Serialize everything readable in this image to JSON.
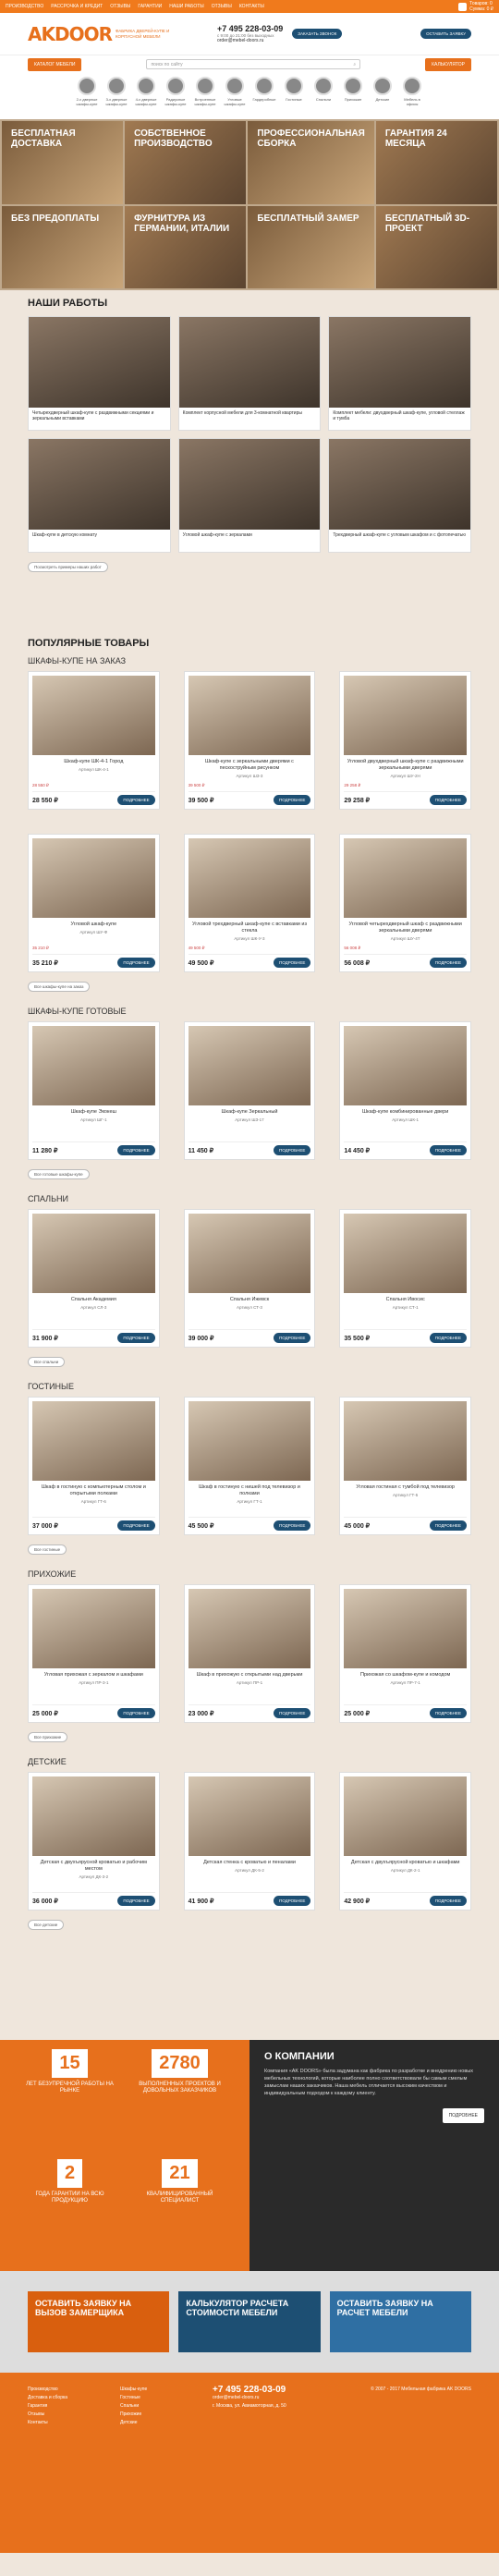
{
  "topnav": [
    "Производство",
    "Рассрочка и кредит",
    "Отзывы",
    "Гарантии",
    "Наши работы",
    "Отзывы",
    "Контакты"
  ],
  "cart": {
    "label1": "Товаров: 0",
    "label2": "Сумма: 0 ₽"
  },
  "logo": {
    "mark": "AKDOOR",
    "tagline": "ФАБРИКА ДВЕРЕЙ-КУПЕ И КОРПУСНОЙ МЕБЕЛИ"
  },
  "header": {
    "phone": "+7 495 228-03-09",
    "hours": "с 9:00 до 21:00 без выходных",
    "email": "order@mebel-doors.ru",
    "callback": "Заказать звонок",
    "order": "Оставить заявку"
  },
  "catalog": {
    "button": "Каталог мебели",
    "search_placeholder": "поиск по сайту",
    "calc": "Калькулятор"
  },
  "categories": [
    "2-х дверные шкафы-купе",
    "3-х дверные шкафы-купе",
    "4-х дверные шкафы-купе",
    "Радиусные шкафы-купе",
    "Встроенные шкафы-купе",
    "Угловые шкафы-купе",
    "Гардеробные",
    "Гостиные",
    "Спальни",
    "Прихожие",
    "Детские",
    "Мебель в офисы"
  ],
  "features": [
    "Бесплатная доставка",
    "Собственное производство",
    "Профессиональная сборка",
    "Гарантия 24 месяца",
    "Без предоплаты",
    "Фурнитура из Германии, Италии",
    "Бесплатный замер",
    "Бесплатный 3D-проект"
  ],
  "works": {
    "title": "Наши работы",
    "items": [
      "Четырехдверный шкаф-купе с раздвижными секциями и зеркальными вставками",
      "Комплект корпусной мебели для 3-комнатной квартиры",
      "Комплект мебели: двухдверный шкаф-купе, угловой стеллаж и тумба",
      "Шкаф-купе в детскую комнату",
      "Угловой шкаф-купе с зеркалами",
      "Трехдверный шкаф-купе с угловым шкафом и с фотопечатью"
    ],
    "more": "Посмотреть примеры наших работ"
  },
  "products": {
    "title": "Популярные товары",
    "groups": [
      {
        "name": "Шкафы-купе на заказ",
        "items": [
          {
            "name": "Шкаф-купе ШК-4-1 Город",
            "art": "Артикул ШК-4-1",
            "old": "28 550 ₽",
            "price": "28 550 ₽"
          },
          {
            "name": "Шкаф-купе с зеркальными дверями с пескоструйным рисунком",
            "art": "Артикул ШЗ-3",
            "old": "39 500 ₽",
            "price": "39 500 ₽"
          },
          {
            "name": "Угловой двухдверный шкаф-купе с раздвижными зеркальными дверями",
            "art": "Артикул ШУ-2Н",
            "old": "29 258 ₽",
            "price": "29 258 ₽"
          },
          {
            "name": "Угловой шкаф-купе",
            "art": "Артикул ШУ-Ф",
            "old": "35 210 ₽",
            "price": "35 210 ₽"
          },
          {
            "name": "Угловой трехдверный шкаф-купе с вставками из стекла",
            "art": "Артикул ШК-У-3",
            "old": "49 500 ₽",
            "price": "49 500 ₽"
          },
          {
            "name": "Угловой четырехдверный шкаф с раздвижными зеркальными дверями",
            "art": "Артикул ШУ-4Т",
            "old": "56 008 ₽",
            "price": "56 008 ₽"
          }
        ],
        "more": "Все шкафы-купе на заказ"
      },
      {
        "name": "Шкафы-купе готовые",
        "items": [
          {
            "name": "Шкаф-купе Экокеш",
            "art": "Артикул ШГ-1",
            "old": "",
            "price": "11 280 ₽"
          },
          {
            "name": "Шкаф-купе Зеркальный",
            "art": "Артикул ШЗ-17",
            "old": "",
            "price": "11 450 ₽"
          },
          {
            "name": "Шкаф-купе комбинированные двери",
            "art": "Артикул ШК-1",
            "old": "",
            "price": "14 450 ₽"
          }
        ],
        "more": "Все готовые шкафы-купе"
      },
      {
        "name": "Спальни",
        "items": [
          {
            "name": "Спальня Академия",
            "art": "Артикул СЛ-3",
            "old": "",
            "price": "31 900 ₽"
          },
          {
            "name": "Спальня Ижевск",
            "art": "Артикул СТ-3",
            "old": "",
            "price": "39 000 ₽"
          },
          {
            "name": "Спальня Ивосис",
            "art": "Артикул СТ-1",
            "old": "",
            "price": "35 500 ₽"
          }
        ],
        "more": "Все спальни"
      },
      {
        "name": "Гостиные",
        "items": [
          {
            "name": "Шкаф в гостиную с компьютерным столом и открытыми полками",
            "art": "Артикул ГТ-6",
            "old": "",
            "price": "37 000 ₽"
          },
          {
            "name": "Шкаф в гостиную с нишей под телевизор и полками",
            "art": "Артикул ГТ-1",
            "old": "",
            "price": "45 500 ₽"
          },
          {
            "name": "Угловая гостиная с тумбой под телевизор",
            "art": "Артикул ГТ-5",
            "old": "",
            "price": "45 000 ₽"
          }
        ],
        "more": "Все гостиные"
      },
      {
        "name": "Прихожие",
        "items": [
          {
            "name": "Угловая прихожая с зеркалом и шкафами",
            "art": "Артикул ПР-3-1",
            "old": "",
            "price": "25 000 ₽"
          },
          {
            "name": "Шкаф в прихожую с открытыми над дверьми",
            "art": "Артикул ПР-1",
            "old": "",
            "price": "23 000 ₽"
          },
          {
            "name": "Прихожая со шкафом-купе и комодом",
            "art": "Артикул ПР-7-1",
            "old": "",
            "price": "25 000 ₽"
          }
        ],
        "more": "Все прихожие"
      },
      {
        "name": "Детские",
        "items": [
          {
            "name": "Детская с двухъярусной кроватью и рабочим местом",
            "art": "Артикул ДК-3-2",
            "old": "",
            "price": "36 000 ₽"
          },
          {
            "name": "Детская стенка с кроватью и пеналами",
            "art": "Артикул ДК-5-2",
            "old": "",
            "price": "41 900 ₽"
          },
          {
            "name": "Детская с двухъярусной кроватью и шкафами",
            "art": "Артикул ДК-2-1",
            "old": "",
            "price": "42 900 ₽"
          }
        ],
        "more": "Все детские"
      }
    ],
    "order_label": "Подробнее"
  },
  "about": {
    "stats": [
      {
        "num": "15",
        "lbl": "лет безупречной работы на рынке"
      },
      {
        "num": "2780",
        "lbl": "выполненных проектов и довольных заказчиков"
      },
      {
        "num": "2",
        "lbl": "года гарантии на всю продукцию"
      },
      {
        "num": "21",
        "lbl": "квалифицированный специалист"
      }
    ],
    "title": "О компании",
    "text": "Компания «AK DOORS» была задумана как фабрика по разработке и внедрению новых мебельных технологий, которые наиболее полно соответствовали бы самым смелым замыслам наших заказчиков. Наша мебель отличается высоким качеством и индивидуальным подходом к каждому клиенту.",
    "more": "Подробнее"
  },
  "promos": [
    {
      "text": "Оставить заявку на вызов замерщика"
    },
    {
      "text": "Калькулятор расчета стоимости мебели"
    },
    {
      "text": "Оставить заявку на расчет мебели"
    }
  ],
  "footer": {
    "col1": [
      "Производство",
      "Доставка и сборка",
      "Гарантия",
      "Отзывы",
      "Контакты"
    ],
    "col2": [
      "Шкафы-купе",
      "Гостиные",
      "Спальни",
      "Прихожие",
      "Детские"
    ],
    "phone": "+7 495 228-03-09",
    "email": "order@mebel-doors.ru",
    "address": "г. Москва, ул. Авиамоторная, д. 50",
    "copyright": "© 2007 - 2017 Мебельная фабрика AK DOORS"
  }
}
